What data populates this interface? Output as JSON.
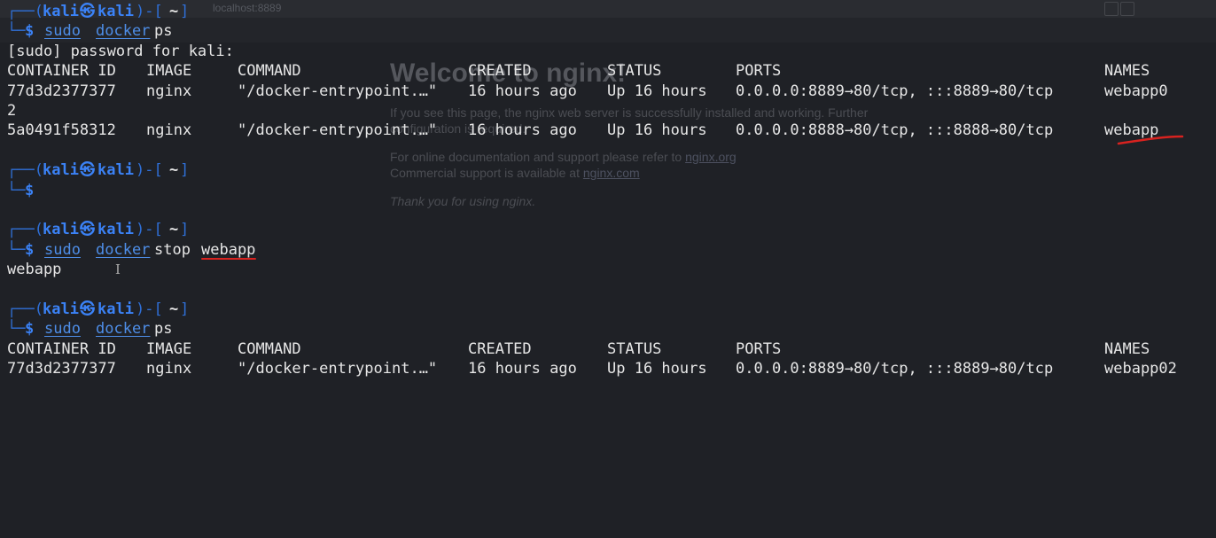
{
  "background_page": {
    "url_hint": "localhost:8889",
    "heading": "Welcome to nginx!",
    "para1": "If you see this page, the nginx web server is successfully installed and working. Further configuration is required.",
    "para2_prefix": "For online documentation and support please refer to ",
    "para2_link": "nginx.org",
    "para3_prefix": "Commercial support is available at ",
    "para3_link": "nginx.com",
    "para4": "Thank you for using nginx."
  },
  "prompt": {
    "frame_top": "┌──(",
    "user": "kali",
    "at": "㉿",
    "host": "kali",
    "close": ")-[",
    "dir": "~",
    "end": "]",
    "frame_bottom": "└─",
    "dollar": "$"
  },
  "commands": {
    "sudo": "sudo",
    "docker": "docker",
    "ps": "ps",
    "stop": "stop",
    "stop_target": "webapp"
  },
  "password_prompt": "[sudo] password for kali:",
  "headers": {
    "container_id": "CONTAINER ID",
    "image": "IMAGE",
    "command": "COMMAND",
    "created": "CREATED",
    "status": "STATUS",
    "ports": "PORTS",
    "names": "NAMES"
  },
  "ps1_rows": [
    {
      "container_id": "77d3d2377377",
      "image": "nginx",
      "command": "\"/docker-entrypoint.…\"",
      "created": "16 hours ago",
      "status": "Up 16 hours",
      "ports": "0.0.0.0:8889→80/tcp, :::8889→80/tcp",
      "names": "webapp0",
      "wrap": "2"
    },
    {
      "container_id": "5a0491f58312",
      "image": "nginx",
      "command": "\"/docker-entrypoint.…\"",
      "created": "16 hours ago",
      "status": "Up 16 hours",
      "ports": "0.0.0.0:8888→80/tcp, :::8888→80/tcp",
      "names": "webapp"
    }
  ],
  "stop_output": "webapp",
  "ps2_rows": [
    {
      "container_id": "77d3d2377377",
      "image": "nginx",
      "command": "\"/docker-entrypoint.…\"",
      "created": "16 hours ago",
      "status": "Up 16 hours",
      "ports": "0.0.0.0:8889→80/tcp, :::8889→80/tcp",
      "names": "webapp02"
    }
  ],
  "colors": {
    "terminal_bg": "#1f2126",
    "prompt_frame": "#2f6fd6",
    "prompt_user": "#3b82f6",
    "command_blue": "#4e8ee8",
    "text": "#e6e6e6",
    "annotation_red": "#d8221f"
  }
}
